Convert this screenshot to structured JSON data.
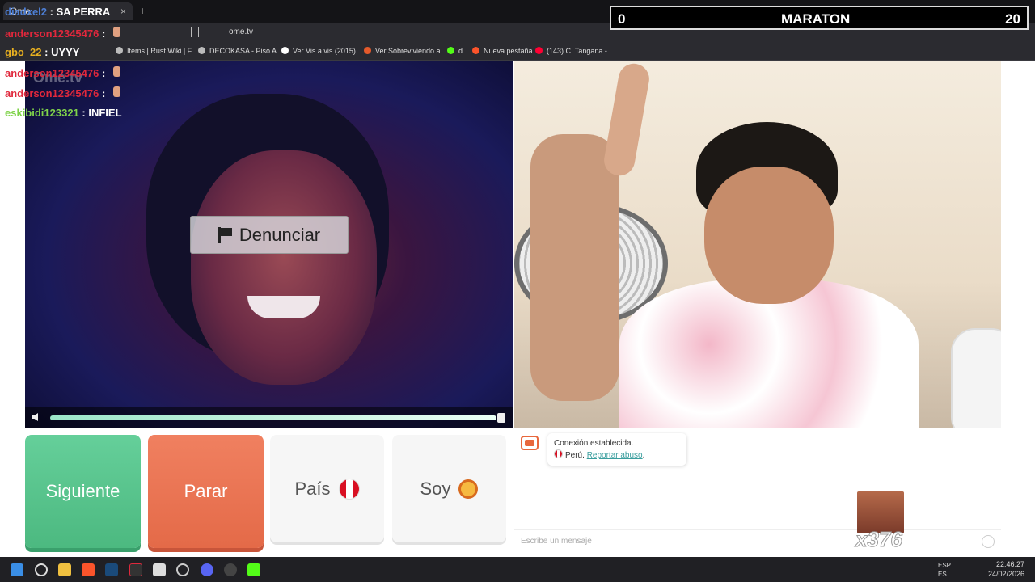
{
  "browser": {
    "tab_title": "Ome",
    "new_tab_symbol": "+",
    "close_symbol": "×",
    "url": "ome.tv",
    "bookmarks": [
      {
        "label": "Items | Rust Wiki | F...",
        "color": "#bbbbbb"
      },
      {
        "label": "DECOKASA - Piso A...",
        "color": "#bbbbbb"
      },
      {
        "label": "Ver Vis a vis (2015)...",
        "color": "#ffffff"
      },
      {
        "label": "Ver Sobreviviendo a...",
        "color": "#e55a2b"
      },
      {
        "label": "d",
        "color": "#53fc18"
      },
      {
        "label": "Nueva pestaña",
        "color": "#fb542b"
      },
      {
        "label": "(143) C. Tangana -...",
        "color": "#ff0033"
      }
    ]
  },
  "stream_overlay": {
    "chat": [
      {
        "user": "diadxel2",
        "sep": " : ",
        "text": "SA PERRA",
        "color": "#4d7fd6"
      },
      {
        "user": "anderson12345476",
        "sep": " :",
        "text": "",
        "color": "#e0283c"
      },
      {
        "user": "gbo_22",
        "sep": " : ",
        "text": "UYYY",
        "color": "#e8b020"
      },
      {
        "user": "anderson12345476",
        "sep": " :",
        "text": "",
        "color": "#e0283c"
      },
      {
        "user": "anderson12345476",
        "sep": " :",
        "text": "",
        "color": "#e0283c"
      },
      {
        "user": "eskibidi123321",
        "sep": " : ",
        "text": "INFIEL",
        "color": "#7fd34a"
      }
    ],
    "score_left": "0",
    "score_title": "MARATON",
    "score_right": "20",
    "sticker_count": "x376"
  },
  "ome": {
    "watermark": "Ome.tv",
    "report_label": "Denunciar",
    "volume_level": 0.99,
    "buttons": {
      "next": "Siguiente",
      "stop": "Parar",
      "country": "País",
      "gender": "Soy"
    },
    "chat": {
      "status": "Conexión establecida.",
      "country": "Perú.",
      "report_link": "Reportar abuso",
      "report_suffix": ".",
      "placeholder": "Escribe un mensaje"
    }
  },
  "taskbar": {
    "time": "22:46:27",
    "date": "24/02/2026",
    "lang1": "ESP",
    "lang2": "ES"
  }
}
